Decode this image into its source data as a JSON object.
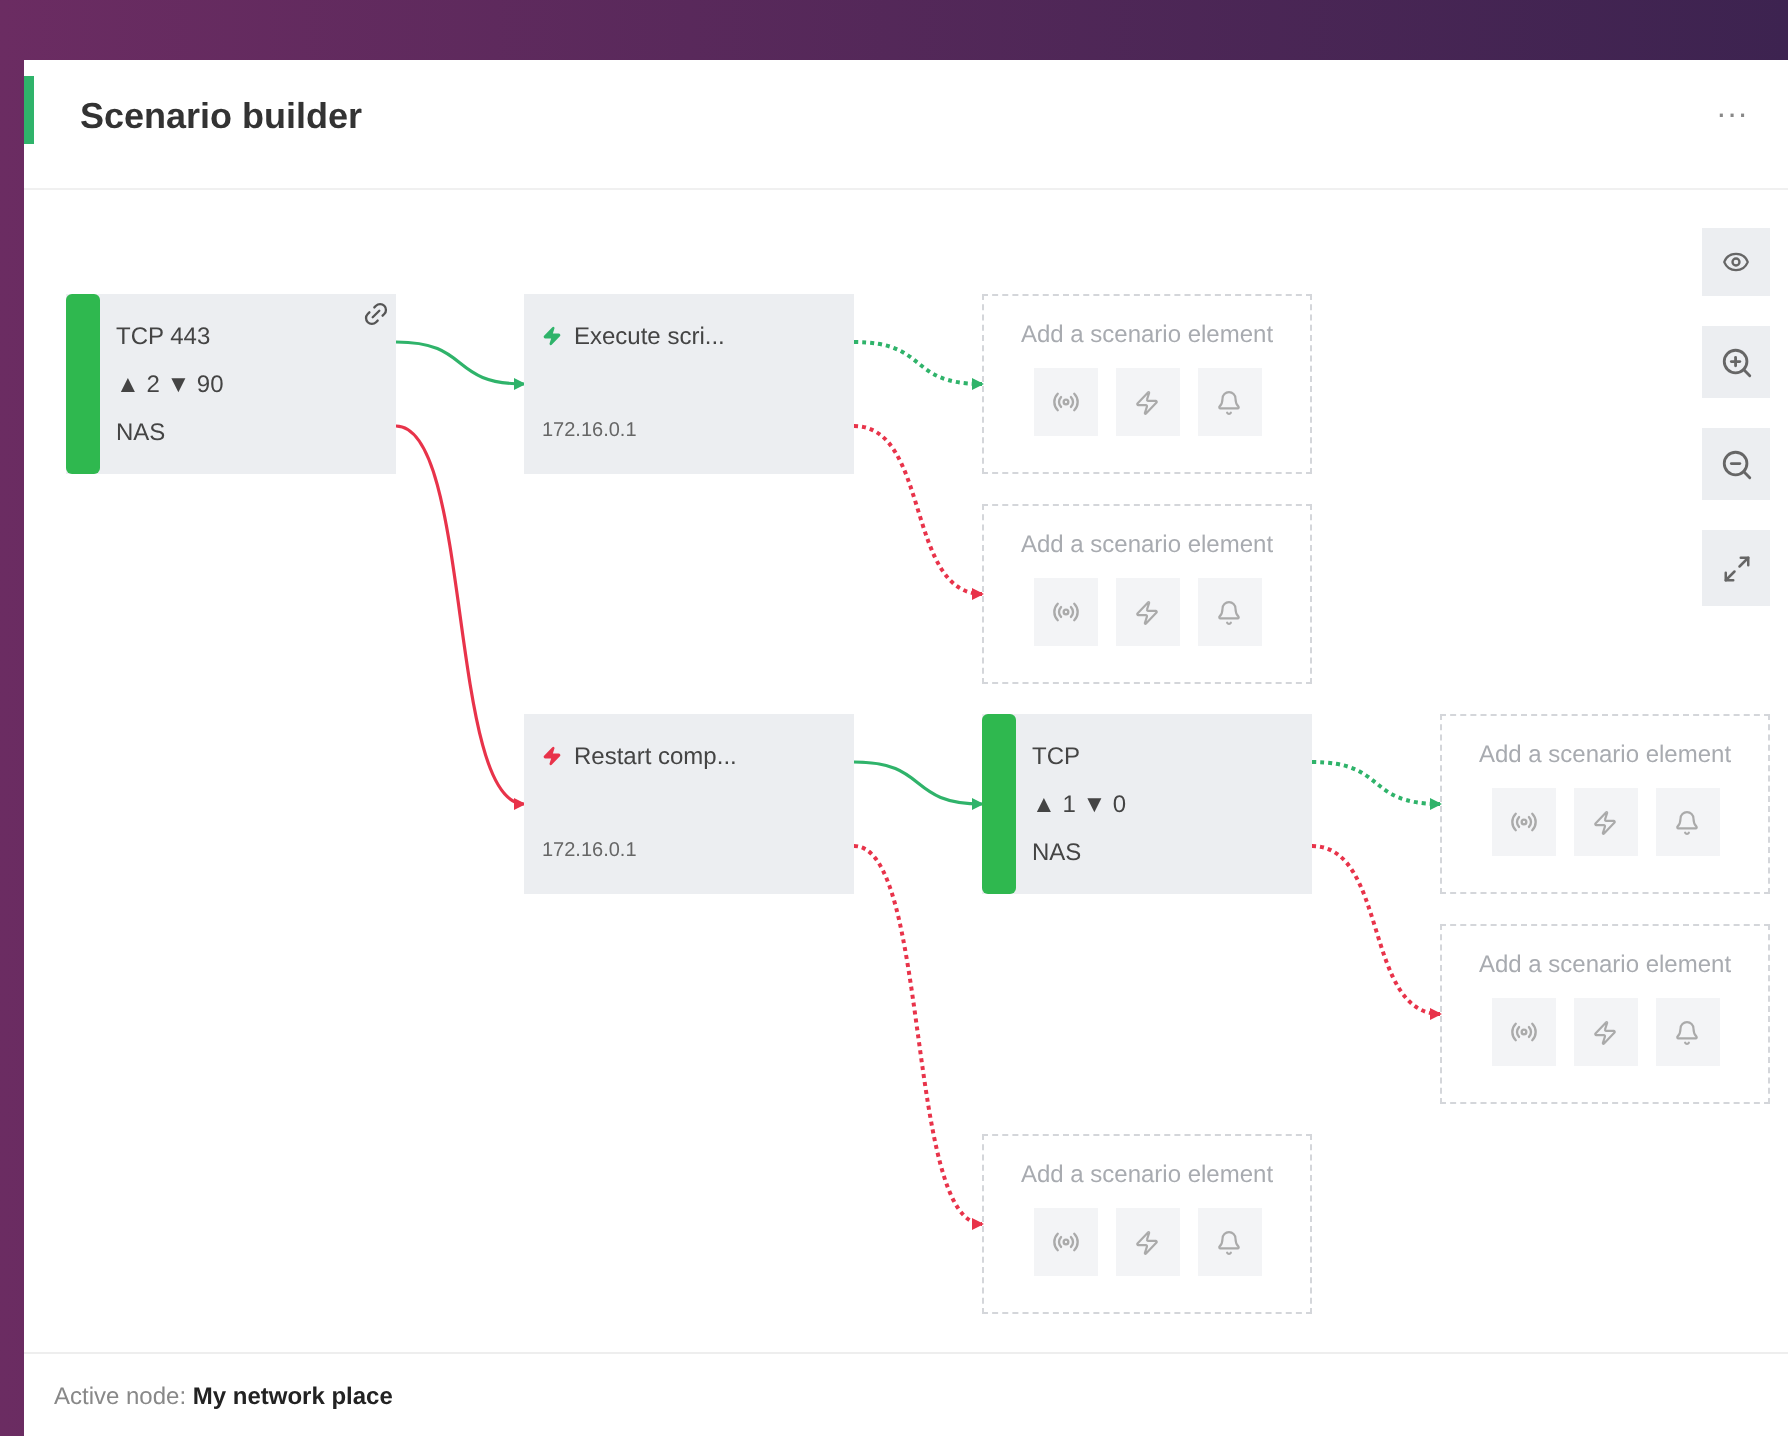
{
  "panel": {
    "title": "Scenario builder",
    "menu": "···"
  },
  "scenario": {
    "kind": "trigger",
    "title": "TCP 443",
    "stats": "▲ 2 ▼ 90",
    "device": "NAS",
    "linked": true,
    "children": [
      {
        "success": true,
        "kind": "action",
        "title": "Execute scri...",
        "address": "172.16.0.1",
        "children": [
          {
            "success": true,
            "kind": "placeholder",
            "label": "Add a scenario element"
          },
          {
            "success": false,
            "kind": "placeholder",
            "label": "Add a scenario element"
          }
        ]
      },
      {
        "success": false,
        "kind": "action",
        "title": "Restart comp...",
        "address": "172.16.0.1",
        "children": [
          {
            "success": true,
            "kind": "trigger",
            "title": "TCP",
            "stats": "▲ 1 ▼ 0",
            "device": "NAS",
            "linked": false,
            "children": [
              {
                "success": true,
                "kind": "placeholder",
                "label": "Add a scenario element"
              },
              {
                "success": false,
                "kind": "placeholder",
                "label": "Add a scenario element"
              }
            ]
          },
          {
            "success": false,
            "kind": "placeholder",
            "label": "Add a scenario element"
          }
        ]
      }
    ]
  },
  "status_bar": {
    "text": "Active node: **My network place**"
  }
}
